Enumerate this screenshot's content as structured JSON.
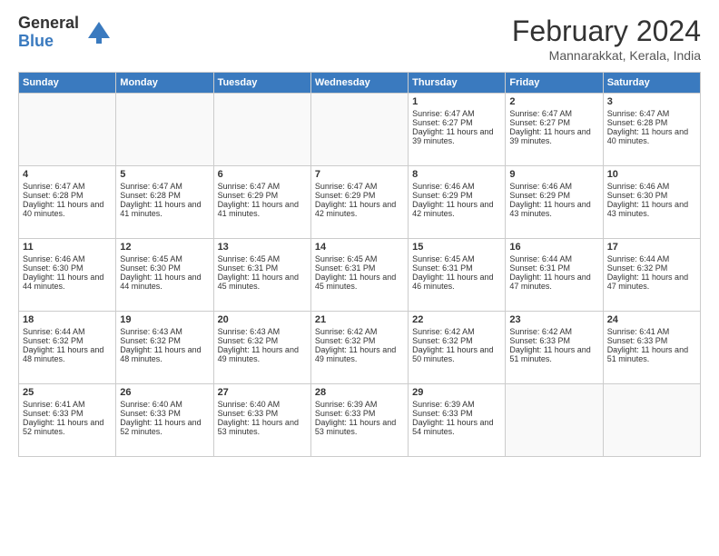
{
  "logo": {
    "general": "General",
    "blue": "Blue"
  },
  "header": {
    "title": "February 2024",
    "subtitle": "Mannarakkat, Kerala, India"
  },
  "weekdays": [
    "Sunday",
    "Monday",
    "Tuesday",
    "Wednesday",
    "Thursday",
    "Friday",
    "Saturday"
  ],
  "weeks": [
    [
      {
        "day": "",
        "info": ""
      },
      {
        "day": "",
        "info": ""
      },
      {
        "day": "",
        "info": ""
      },
      {
        "day": "",
        "info": ""
      },
      {
        "day": "1",
        "info": "Sunrise: 6:47 AM\nSunset: 6:27 PM\nDaylight: 11 hours and 39 minutes."
      },
      {
        "day": "2",
        "info": "Sunrise: 6:47 AM\nSunset: 6:27 PM\nDaylight: 11 hours and 39 minutes."
      },
      {
        "day": "3",
        "info": "Sunrise: 6:47 AM\nSunset: 6:28 PM\nDaylight: 11 hours and 40 minutes."
      }
    ],
    [
      {
        "day": "4",
        "info": "Sunrise: 6:47 AM\nSunset: 6:28 PM\nDaylight: 11 hours and 40 minutes."
      },
      {
        "day": "5",
        "info": "Sunrise: 6:47 AM\nSunset: 6:28 PM\nDaylight: 11 hours and 41 minutes."
      },
      {
        "day": "6",
        "info": "Sunrise: 6:47 AM\nSunset: 6:29 PM\nDaylight: 11 hours and 41 minutes."
      },
      {
        "day": "7",
        "info": "Sunrise: 6:47 AM\nSunset: 6:29 PM\nDaylight: 11 hours and 42 minutes."
      },
      {
        "day": "8",
        "info": "Sunrise: 6:46 AM\nSunset: 6:29 PM\nDaylight: 11 hours and 42 minutes."
      },
      {
        "day": "9",
        "info": "Sunrise: 6:46 AM\nSunset: 6:29 PM\nDaylight: 11 hours and 43 minutes."
      },
      {
        "day": "10",
        "info": "Sunrise: 6:46 AM\nSunset: 6:30 PM\nDaylight: 11 hours and 43 minutes."
      }
    ],
    [
      {
        "day": "11",
        "info": "Sunrise: 6:46 AM\nSunset: 6:30 PM\nDaylight: 11 hours and 44 minutes."
      },
      {
        "day": "12",
        "info": "Sunrise: 6:45 AM\nSunset: 6:30 PM\nDaylight: 11 hours and 44 minutes."
      },
      {
        "day": "13",
        "info": "Sunrise: 6:45 AM\nSunset: 6:31 PM\nDaylight: 11 hours and 45 minutes."
      },
      {
        "day": "14",
        "info": "Sunrise: 6:45 AM\nSunset: 6:31 PM\nDaylight: 11 hours and 45 minutes."
      },
      {
        "day": "15",
        "info": "Sunrise: 6:45 AM\nSunset: 6:31 PM\nDaylight: 11 hours and 46 minutes."
      },
      {
        "day": "16",
        "info": "Sunrise: 6:44 AM\nSunset: 6:31 PM\nDaylight: 11 hours and 47 minutes."
      },
      {
        "day": "17",
        "info": "Sunrise: 6:44 AM\nSunset: 6:32 PM\nDaylight: 11 hours and 47 minutes."
      }
    ],
    [
      {
        "day": "18",
        "info": "Sunrise: 6:44 AM\nSunset: 6:32 PM\nDaylight: 11 hours and 48 minutes."
      },
      {
        "day": "19",
        "info": "Sunrise: 6:43 AM\nSunset: 6:32 PM\nDaylight: 11 hours and 48 minutes."
      },
      {
        "day": "20",
        "info": "Sunrise: 6:43 AM\nSunset: 6:32 PM\nDaylight: 11 hours and 49 minutes."
      },
      {
        "day": "21",
        "info": "Sunrise: 6:42 AM\nSunset: 6:32 PM\nDaylight: 11 hours and 49 minutes."
      },
      {
        "day": "22",
        "info": "Sunrise: 6:42 AM\nSunset: 6:32 PM\nDaylight: 11 hours and 50 minutes."
      },
      {
        "day": "23",
        "info": "Sunrise: 6:42 AM\nSunset: 6:33 PM\nDaylight: 11 hours and 51 minutes."
      },
      {
        "day": "24",
        "info": "Sunrise: 6:41 AM\nSunset: 6:33 PM\nDaylight: 11 hours and 51 minutes."
      }
    ],
    [
      {
        "day": "25",
        "info": "Sunrise: 6:41 AM\nSunset: 6:33 PM\nDaylight: 11 hours and 52 minutes."
      },
      {
        "day": "26",
        "info": "Sunrise: 6:40 AM\nSunset: 6:33 PM\nDaylight: 11 hours and 52 minutes."
      },
      {
        "day": "27",
        "info": "Sunrise: 6:40 AM\nSunset: 6:33 PM\nDaylight: 11 hours and 53 minutes."
      },
      {
        "day": "28",
        "info": "Sunrise: 6:39 AM\nSunset: 6:33 PM\nDaylight: 11 hours and 53 minutes."
      },
      {
        "day": "29",
        "info": "Sunrise: 6:39 AM\nSunset: 6:33 PM\nDaylight: 11 hours and 54 minutes."
      },
      {
        "day": "",
        "info": ""
      },
      {
        "day": "",
        "info": ""
      }
    ]
  ]
}
